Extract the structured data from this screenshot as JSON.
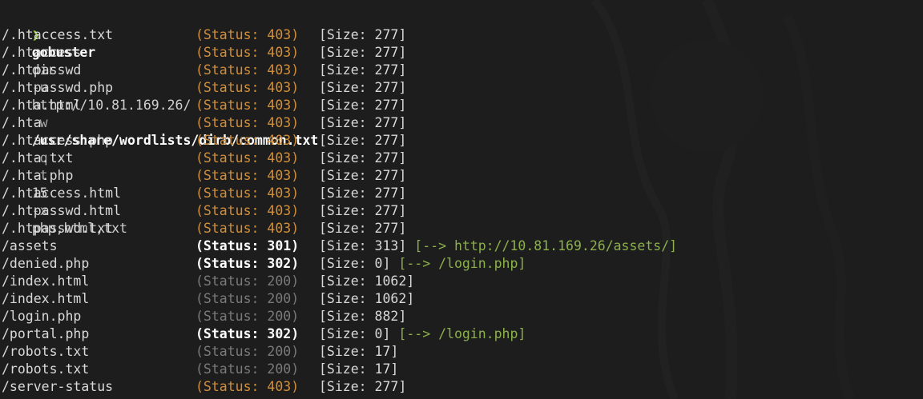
{
  "prompt": {
    "arrow": "❯",
    "command": "gobuster",
    "subcommand": "dir",
    "flag_u": "-u",
    "url": "http://10.81.169.26/",
    "flag_w": "-w",
    "wordlist": "/usr/share/wordlists/dirb/common.txt",
    "flag_q": "-q",
    "flag_t": "-t",
    "threads": "15",
    "flag_x": "-x",
    "extensions": "php,html,txt"
  },
  "colors": {
    "status_403": "#d28f3a",
    "status_3xx": "#ffffff",
    "status_200": "#7a7a7a",
    "redirect": "#8bb04c",
    "prompt_arrow": "#9bd13a",
    "background": "#1d1d1d"
  },
  "results": [
    {
      "path": "/.htaccess.txt",
      "status": "(Status: 403)",
      "code": "403",
      "size": "[Size: 277]",
      "redirect": ""
    },
    {
      "path": "/.htaccess",
      "status": "(Status: 403)",
      "code": "403",
      "size": "[Size: 277]",
      "redirect": ""
    },
    {
      "path": "/.htpasswd",
      "status": "(Status: 403)",
      "code": "403",
      "size": "[Size: 277]",
      "redirect": ""
    },
    {
      "path": "/.htpasswd.php",
      "status": "(Status: 403)",
      "code": "403",
      "size": "[Size: 277]",
      "redirect": ""
    },
    {
      "path": "/.hta.html",
      "status": "(Status: 403)",
      "code": "403",
      "size": "[Size: 277]",
      "redirect": ""
    },
    {
      "path": "/.hta",
      "status": "(Status: 403)",
      "code": "403",
      "size": "[Size: 277]",
      "redirect": ""
    },
    {
      "path": "/.htaccess.php",
      "status": "(Status: 403)",
      "code": "403",
      "size": "[Size: 277]",
      "redirect": ""
    },
    {
      "path": "/.hta.txt",
      "status": "(Status: 403)",
      "code": "403",
      "size": "[Size: 277]",
      "redirect": ""
    },
    {
      "path": "/.hta.php",
      "status": "(Status: 403)",
      "code": "403",
      "size": "[Size: 277]",
      "redirect": ""
    },
    {
      "path": "/.htaccess.html",
      "status": "(Status: 403)",
      "code": "403",
      "size": "[Size: 277]",
      "redirect": ""
    },
    {
      "path": "/.htpasswd.html",
      "status": "(Status: 403)",
      "code": "403",
      "size": "[Size: 277]",
      "redirect": ""
    },
    {
      "path": "/.htpasswd.txt",
      "status": "(Status: 403)",
      "code": "403",
      "size": "[Size: 277]",
      "redirect": ""
    },
    {
      "path": "/assets",
      "status": "(Status: 301)",
      "code": "301",
      "size": "[Size: 313]",
      "redirect": "[--> http://10.81.169.26/assets/]"
    },
    {
      "path": "/denied.php",
      "status": "(Status: 302)",
      "code": "302",
      "size": "[Size: 0]",
      "redirect": "[--> /login.php]"
    },
    {
      "path": "/index.html",
      "status": "(Status: 200)",
      "code": "200",
      "size": "[Size: 1062]",
      "redirect": ""
    },
    {
      "path": "/index.html",
      "status": "(Status: 200)",
      "code": "200",
      "size": "[Size: 1062]",
      "redirect": ""
    },
    {
      "path": "/login.php",
      "status": "(Status: 200)",
      "code": "200",
      "size": "[Size: 882]",
      "redirect": ""
    },
    {
      "path": "/portal.php",
      "status": "(Status: 302)",
      "code": "302",
      "size": "[Size: 0]",
      "redirect": "[--> /login.php]"
    },
    {
      "path": "/robots.txt",
      "status": "(Status: 200)",
      "code": "200",
      "size": "[Size: 17]",
      "redirect": ""
    },
    {
      "path": "/robots.txt",
      "status": "(Status: 200)",
      "code": "200",
      "size": "[Size: 17]",
      "redirect": ""
    },
    {
      "path": "/server-status",
      "status": "(Status: 403)",
      "code": "403",
      "size": "[Size: 277]",
      "redirect": ""
    }
  ]
}
